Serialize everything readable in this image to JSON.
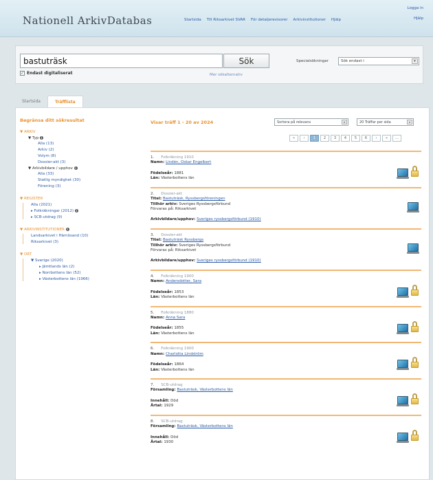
{
  "header": {
    "logo_main": "Nationell ArkivDatabas",
    "top_links": [
      "Logga in",
      "Hjälp"
    ],
    "nav": [
      "Startsida",
      "Till Riksarkivet SVAR",
      "För detaljerevisorer",
      "Arkivinstitutioner",
      "Hjälp"
    ]
  },
  "search": {
    "value": "bastuträsk",
    "button": "Sök",
    "digitized_label": "Endast digitaliserat",
    "digitized_check": "✓",
    "advanced_link": "Mer sökalternativ",
    "special_label": "Specialsökningar",
    "special_value": "Sök endast i",
    "select_arrow": "▾"
  },
  "tabs": [
    "Startsida",
    "Träfflista"
  ],
  "sidebar": {
    "title": "Begränsa ditt sökresultat",
    "arkiv": {
      "title": "▼ ARKIV",
      "typ": "▼ Typ",
      "typ_items": [
        "Alla (13)",
        "Arkiv (2)",
        "Volym (8)",
        "Dossier-akt (3)"
      ],
      "arkivbildare": "▼ Arkivbildare / upphov",
      "arkivbildare_items": [
        "Alla (33)",
        "Statlig myndighet (30)",
        "Förening (3)"
      ]
    },
    "register": {
      "title": "▼ REGISTER",
      "items": [
        "Alla (2021)",
        "▸ Folkräkningar (2012)",
        "▸ SCB-utdrag (9)"
      ]
    },
    "arkivinst": {
      "title": "▼ ARKIVINSTITUTIONER",
      "items": [
        "Landsarkivet i Härnösand (10)",
        "Riksarkivet (3)"
      ]
    },
    "ort": {
      "title": "▼ ORT",
      "country": "▼ Sverige (2020)",
      "items": [
        "▸ Jämtlands län (2)",
        "▸ Norrbottens län (52)",
        "▸ Västerbottens län (1966)"
      ]
    },
    "info_glyph": "i"
  },
  "results": {
    "heading": "Visar träff 1 - 20 av 2024",
    "sort_value": "Sortera på relevans",
    "per_page_value": "20 Träffar per sida",
    "pager": [
      "«",
      "‹",
      "1",
      "2",
      "3",
      "4",
      "5",
      "6",
      "›",
      "»",
      "…"
    ],
    "items": [
      {
        "num": "1.",
        "type": "Folkräkning 1910",
        "lines": [
          {
            "label": "Namn:",
            "value": "Lindén, Oskar Engelbert",
            "link": true
          }
        ],
        "lines2": [
          {
            "label": "Födelseår:",
            "value": "1881"
          },
          {
            "label": "Län:",
            "value": "Västerbottens län"
          }
        ],
        "icons": 2
      },
      {
        "num": "2.",
        "type": "Dossier-akt",
        "lines": [
          {
            "label": "Titel:",
            "value": "Bastuträsk, Ryssbergsföreningen",
            "link": true
          },
          {
            "label": "Tillhör arkiv:",
            "value": "Sveriges Ryssbergsförbund"
          },
          {
            "label": "",
            "value": "Förvaras på: Riksarkivet"
          }
        ],
        "lines2": [
          {
            "label": "Arkivbildare/upphov:",
            "value": "Sveriges ryssbergsförbund (1910)",
            "link": true
          }
        ],
        "icons": 1
      },
      {
        "num": "3.",
        "type": "Dossier-akt",
        "lines": [
          {
            "label": "Titel:",
            "value": "Bastuträsk Ryssbergs",
            "link": true
          },
          {
            "label": "Tillhör arkiv:",
            "value": "Sveriges Ryssbergsförbund"
          },
          {
            "label": "",
            "value": "Förvaras på: Riksarkivet"
          }
        ],
        "lines2": [
          {
            "label": "Arkivbildare/upphov:",
            "value": "Sveriges ryssbergsförbund (1910)",
            "link": true
          }
        ],
        "icons": 1
      },
      {
        "num": "4.",
        "type": "Folkräkning 1900",
        "lines": [
          {
            "label": "Namn:",
            "value": "Andersdotter, Sara",
            "link": true
          }
        ],
        "lines2": [
          {
            "label": "Födelseår:",
            "value": "1853"
          },
          {
            "label": "Län:",
            "value": "Västerbottens län"
          }
        ],
        "icons": 2
      },
      {
        "num": "5.",
        "type": "Folkräkning 1880",
        "lines": [
          {
            "label": "Namn:",
            "value": "Anna Sara",
            "link": true
          }
        ],
        "lines2": [
          {
            "label": "Födelseår:",
            "value": "1855"
          },
          {
            "label": "Län:",
            "value": "Västerbottens län"
          }
        ],
        "icons": 2
      },
      {
        "num": "6.",
        "type": "Folkräkning 1900",
        "lines": [
          {
            "label": "Namn:",
            "value": "Charlotta Lindström",
            "link": true
          }
        ],
        "lines2": [
          {
            "label": "Födelseår:",
            "value": "1864"
          },
          {
            "label": "Län:",
            "value": "Västerbottens län"
          }
        ],
        "icons": 2
      },
      {
        "num": "7.",
        "type": "SCB-utdrag",
        "lines": [
          {
            "label": "Församling:",
            "value": "Bastuträsk, Västerbottens län",
            "link": true
          }
        ],
        "lines2": [
          {
            "label": "Innehåll:",
            "value": "Död"
          },
          {
            "label": "Årtal:",
            "value": "1929"
          }
        ],
        "icons": 2
      },
      {
        "num": "8.",
        "type": "SCB-utdrag",
        "lines": [
          {
            "label": "Församling:",
            "value": "Bastuträsk, Västerbottens län",
            "link": true
          }
        ],
        "lines2": [
          {
            "label": "Innehåll:",
            "value": "Död"
          },
          {
            "label": "Årtal:",
            "value": "1930"
          }
        ],
        "icons": 2
      }
    ]
  }
}
